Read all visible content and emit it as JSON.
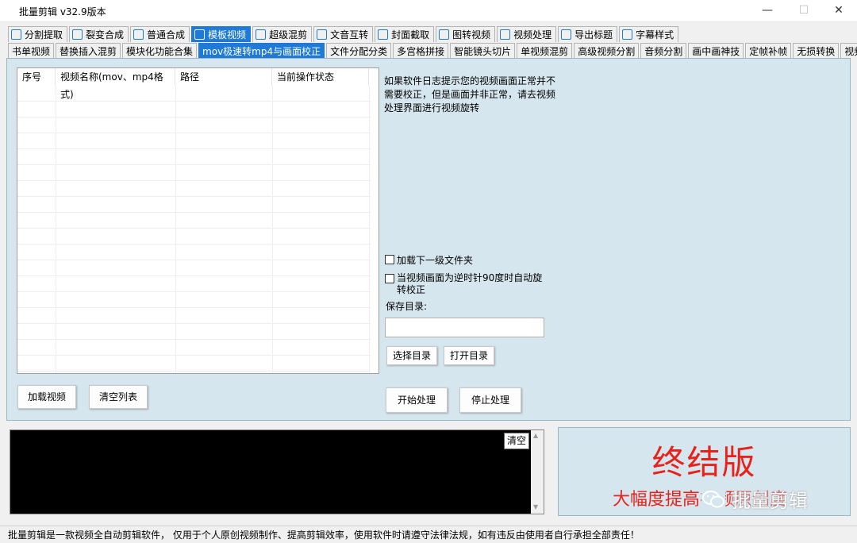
{
  "window": {
    "title": "批量剪辑   v32.9版本",
    "minimize": "—",
    "maximize": "☐",
    "close": "✕"
  },
  "main_tabs": [
    {
      "label": "分割提取",
      "icon": "play-icon",
      "active": false
    },
    {
      "label": "裂变合成",
      "icon": "square-icon",
      "active": false
    },
    {
      "label": "普通合成",
      "icon": "play-icon",
      "active": false
    },
    {
      "label": "模板视频",
      "icon": "image-icon",
      "active": true
    },
    {
      "label": "超级混剪",
      "icon": "waveform-icon",
      "active": false
    },
    {
      "label": "文音互转",
      "icon": "microphone-icon",
      "active": false
    },
    {
      "label": "封面截取",
      "icon": "picture-icon",
      "active": false
    },
    {
      "label": "图转视频",
      "icon": "slideshow-icon",
      "active": false
    },
    {
      "label": "视频处理",
      "icon": "film-icon",
      "active": false
    },
    {
      "label": "导出标题",
      "icon": "export-icon",
      "active": false
    },
    {
      "label": "字幕样式",
      "icon": "subtitle-icon",
      "active": false
    }
  ],
  "sub_tabs": [
    {
      "label": "书单视频",
      "active": false
    },
    {
      "label": "替换插入混剪",
      "active": false
    },
    {
      "label": "模块化功能合集",
      "active": false
    },
    {
      "label": "mov极速转mp4与画面校正",
      "active": true
    },
    {
      "label": "文件分配分类",
      "active": false
    },
    {
      "label": "多宫格拼接",
      "active": false
    },
    {
      "label": "智能镜头切片",
      "active": false
    },
    {
      "label": "单视频混剪",
      "active": false
    },
    {
      "label": "高级视频分割",
      "active": false
    },
    {
      "label": "音频分割",
      "active": false
    },
    {
      "label": "画中画神技",
      "active": false
    },
    {
      "label": "定帧补帧",
      "active": false
    },
    {
      "label": "无损转换",
      "active": false
    },
    {
      "label": "视频截图",
      "active": false
    }
  ],
  "list": {
    "columns": [
      "序号",
      "视频名称(mov、mp4格式)",
      "路径",
      "当前操作状态"
    ],
    "rows": []
  },
  "buttons": {
    "load_video": "加载视频",
    "clear_list": "清空列表",
    "choose_dir": "选择目录",
    "open_dir": "打开目录",
    "start": "开始处理",
    "stop": "停止处理",
    "clear_log": "清空"
  },
  "info_text": "如果软件日志提示您的视频画面正常并不需要校正，但是画面并非正常，请去视频处理界面进行视频旋转",
  "options": {
    "load_subfolders": "加载下一级文件夹",
    "auto_rotate": "当视频画面为逆时针90度时自动旋转校正"
  },
  "save_dir": {
    "label": "保存目录:",
    "value": ""
  },
  "log": {
    "up": "▲",
    "down": "▼"
  },
  "promo": {
    "title": "终结版",
    "subtitle": "大幅度提高",
    "subtitle_tail": "视频原创度",
    "watermark": "批量剪辑",
    "title_color": "#e8221b"
  },
  "status_text": "批量剪辑是一款视频全自动剪辑软件，  仅用于个人原创视频制作、提高剪辑效率，使用软件时请遵守法律法规，如有违反由使用者自行承担全部责任！"
}
